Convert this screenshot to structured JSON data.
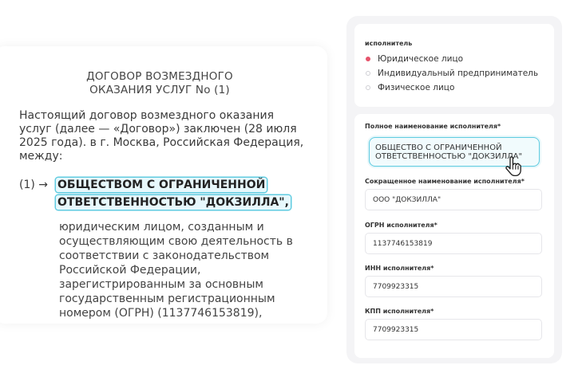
{
  "document": {
    "title": "ДОГОВОР ВОЗМЕЗДНОГО ОКАЗАНИЯ УСЛУГ No (1)",
    "intro": "Настоящий договор возмездного оказания услуг (далее — «Договор») заключен (28 июля 2025 года). в г. Москва, Российская Федерация, между:",
    "party_number": "(1) →",
    "party_name": "ОБЩЕСТВОМ С ОГРАНИЧЕННОЙ ОТВЕТСТВЕННОСТЬЮ \"ДОКЗИЛЛА\",",
    "party_body": "юридическим лицом, созданным и осуществляющим свою деятельность в соответствии с законодательством Российской Федерации, зарегистрированным за основным государственным регистрационным номером (ОГРН) (1137746153819),"
  },
  "executor": {
    "title": "исполнитель",
    "options": [
      {
        "label": "Юридическое лицо",
        "selected": true
      },
      {
        "label": "Индивидуальный предприниматель",
        "selected": false
      },
      {
        "label": "Физическое лицо",
        "selected": false
      }
    ]
  },
  "form": {
    "full_name": {
      "label": "Полное наименование исполнителя*",
      "value": "ОБЩЕСТВО С ОГРАНИЧЕННОЙ ОТВЕТСТВЕННОСТЬЮ \"ДОКЗИЛЛА\""
    },
    "short_name": {
      "label": "Сокращенное наименование исполнителя*",
      "value": "ООО \"ДОКЗИЛЛА\""
    },
    "ogrn": {
      "label": "ОГРН исполнителя*",
      "value": "1137746153819"
    },
    "inn": {
      "label": "ИНН исполнителя*",
      "value": "7709923315"
    },
    "kpp": {
      "label": "КПП исполнителя*",
      "value": "7709923315"
    }
  },
  "colors": {
    "accent": "#5fcbe0",
    "radio_selected": "#e6536b",
    "panel_bg": "#f4f4f6"
  },
  "icons": {
    "cursor": "hand-pointer-icon"
  }
}
